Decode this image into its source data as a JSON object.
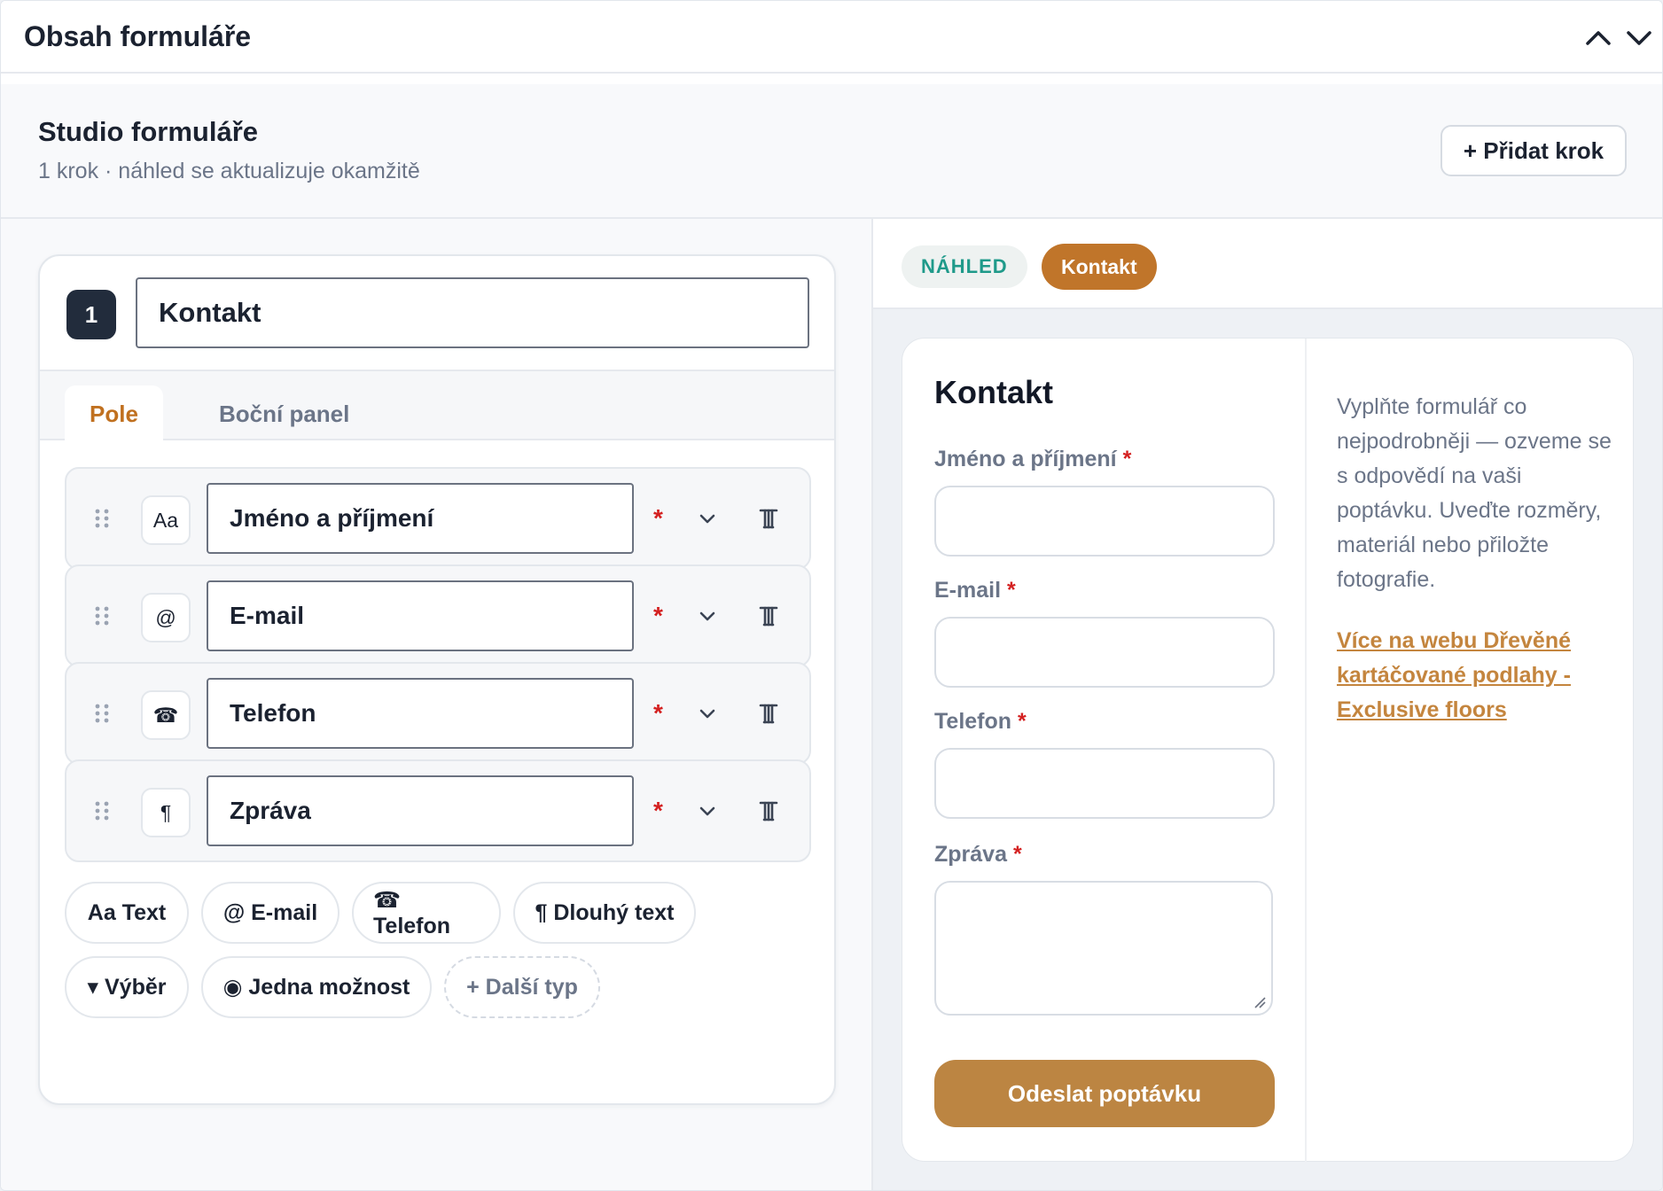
{
  "header": {
    "title": "Obsah formuláře",
    "collapse_icon": "chevron-up-icon",
    "expand_icon": "chevron-down-icon"
  },
  "studio": {
    "title": "Studio formuláře",
    "subtitle": "1 krok · náhled se aktualizuje okamžitě",
    "add_step_label": "+ Přidat krok"
  },
  "editor": {
    "step_number": "1",
    "step_name": "Kontakt",
    "tabs": [
      {
        "label": "Pole",
        "active": true
      },
      {
        "label": "Boční panel",
        "active": false
      }
    ],
    "fields": [
      {
        "type_icon": "Aa",
        "label": "Jméno a příjmení",
        "required": "*"
      },
      {
        "type_icon": "@",
        "label": "E-mail",
        "required": "*"
      },
      {
        "type_icon": "☎",
        "label": "Telefon",
        "required": "*"
      },
      {
        "type_icon": "¶",
        "label": "Zpráva",
        "required": "*"
      }
    ],
    "add_chips": [
      {
        "label": "Aa Text"
      },
      {
        "label": "@ E-mail"
      },
      {
        "label": "☎ Telefon"
      },
      {
        "label": "¶ Dlouhý text"
      },
      {
        "label": "▾ Výběr"
      },
      {
        "label": "◉ Jedna možnost"
      },
      {
        "label": "+ Další typ"
      }
    ]
  },
  "preview": {
    "badge": "NÁHLED",
    "step_pill": "Kontakt",
    "form_title": "Kontakt",
    "fields": [
      {
        "label": "Jméno a příjmení",
        "required": "*"
      },
      {
        "label": "E-mail",
        "required": "*"
      },
      {
        "label": "Telefon",
        "required": "*"
      },
      {
        "label": "Zpráva",
        "required": "*"
      }
    ],
    "submit_label": "Odeslat poptávku",
    "side_text": "Vyplňte formulář co nejpodrobněji — ozveme se s odpovědí na vaši poptávku. Uveďte rozměry, materiál nebo přiložte fotografie.",
    "side_link": "Více na webu Dřevěné kartáčované podlahy - Exclusive floors"
  },
  "colors": {
    "accent": "#c0752a",
    "submit": "#bc8542",
    "preview_badge": "#1f9a8a",
    "required": "#d42020",
    "step_num_bg": "#222c3c"
  }
}
